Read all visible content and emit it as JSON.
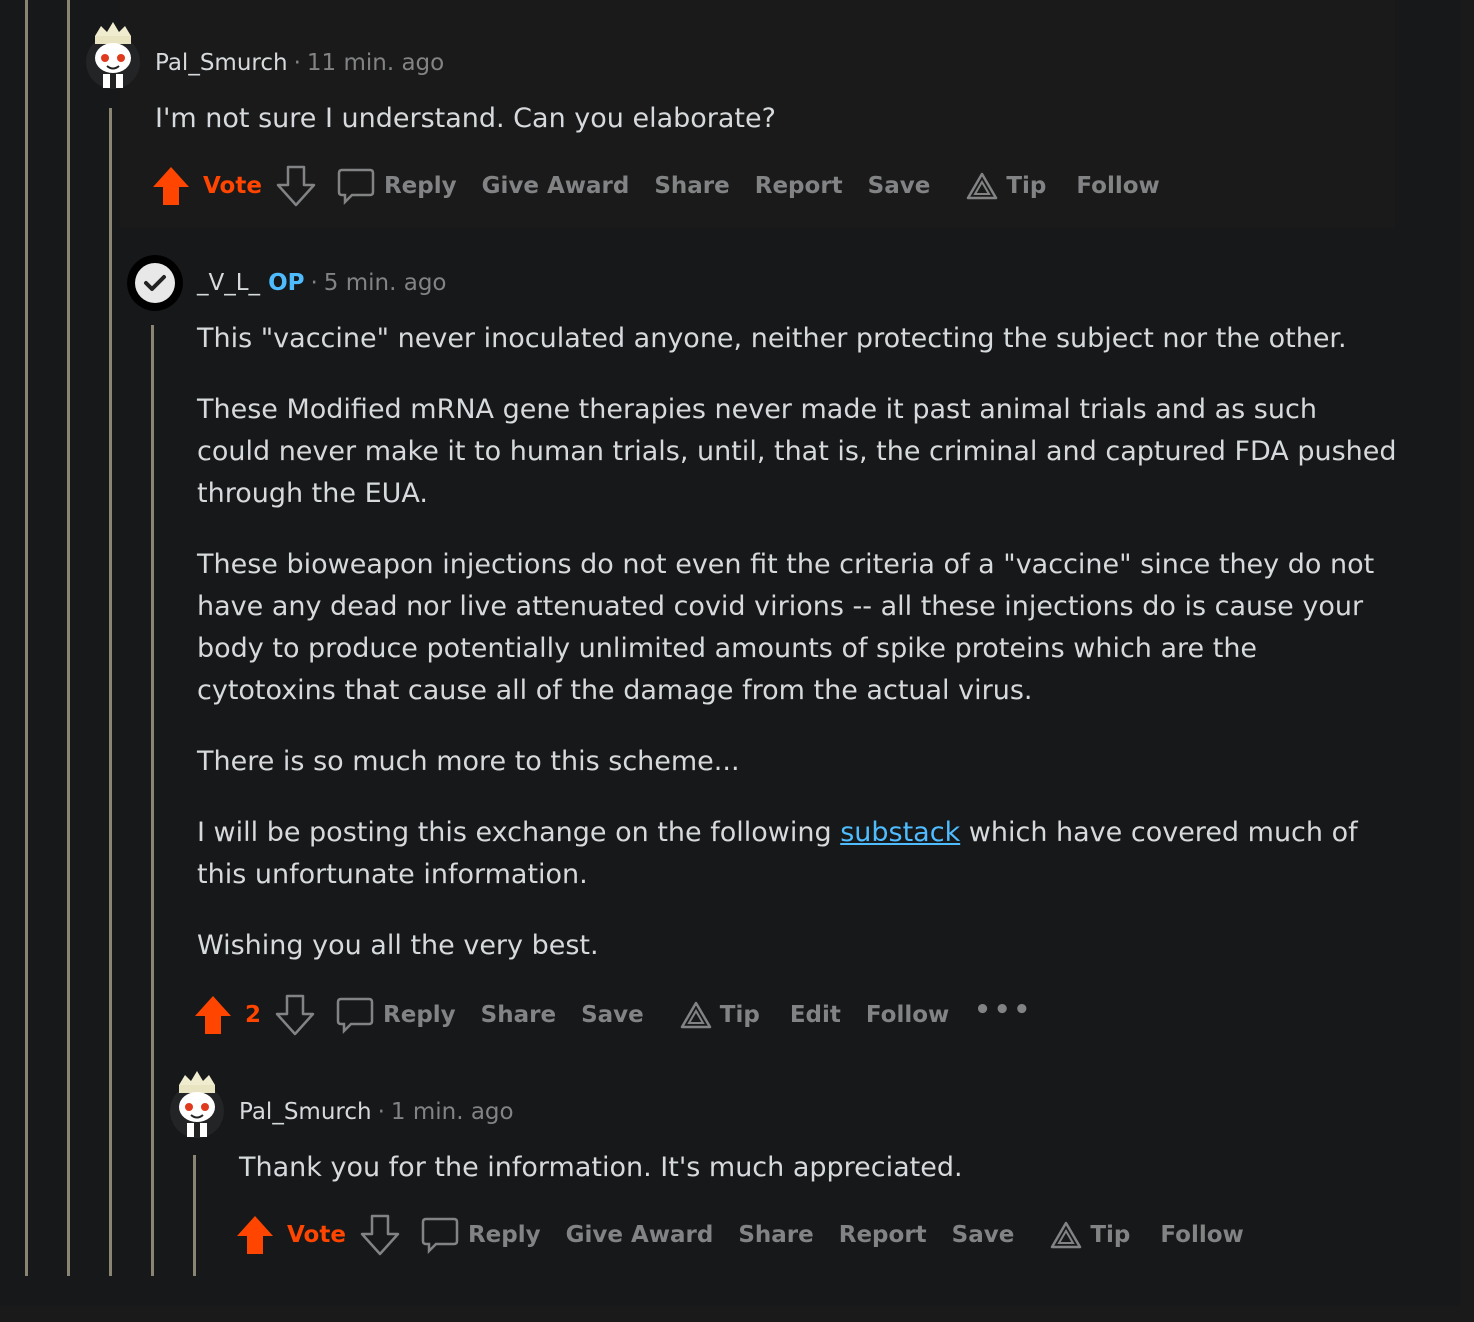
{
  "comments": [
    {
      "username": "Pal_Smurch",
      "time": "11 min. ago",
      "paragraphs": [
        "I'm not sure I understand. Can you elaborate?"
      ],
      "vote_label": "Vote",
      "actions": {
        "reply": "Reply",
        "give_award": "Give Award",
        "share": "Share",
        "report": "Report",
        "save": "Save",
        "tip": "Tip",
        "follow": "Follow"
      }
    },
    {
      "username": "_V_L_",
      "op_badge": "OP",
      "time": "5 min. ago",
      "paragraphs": [
        "This \"vaccine\" never inoculated anyone, neither protecting the subject nor the other.",
        "These Modified mRNA gene therapies never made it past animal trials and as such could never make it to human trials, until, that is, the criminal and captured FDA pushed through the EUA.",
        "These bioweapon injections do not even fit the criteria of a \"vaccine\" since they do not have any dead nor live attenuated covid virions -- all these injections do is cause your body to produce potentially unlimited amounts of spike proteins which are the cytotoxins that cause all of the damage from the actual virus.",
        "There is so much more to this scheme...",
        "Wishing you all the very best."
      ],
      "link_paragraph": {
        "before": "I will be posting this exchange on the following ",
        "link": "substack",
        "after": " which have covered much of this unfortunate information."
      },
      "vote_count": "2",
      "actions": {
        "reply": "Reply",
        "share": "Share",
        "save": "Save",
        "tip": "Tip",
        "edit": "Edit",
        "follow": "Follow",
        "more": "•••"
      }
    },
    {
      "username": "Pal_Smurch",
      "time": "1 min. ago",
      "paragraphs": [
        "Thank you for the information. It's much appreciated."
      ],
      "vote_label": "Vote",
      "actions": {
        "reply": "Reply",
        "give_award": "Give Award",
        "share": "Share",
        "report": "Report",
        "save": "Save",
        "tip": "Tip",
        "follow": "Follow"
      }
    }
  ],
  "colors": {
    "upvote": "#ff4500",
    "op_badge": "#4fbcff",
    "link": "#4fbcff",
    "thread_line": "#8a8572"
  }
}
